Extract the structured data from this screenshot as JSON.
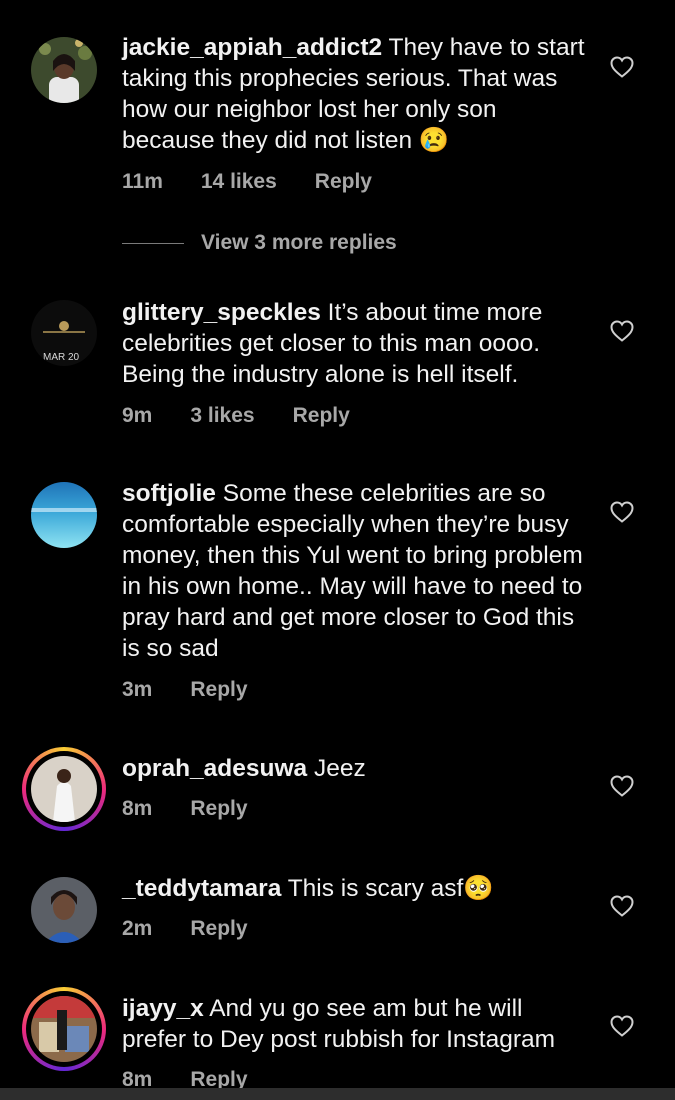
{
  "comments": [
    {
      "username": "jackie_appiah_addict2",
      "text": "They have to start taking this prophecies serious. That was how our neighbor lost her only son because they did not listen 😢",
      "time": "11m",
      "likes": "14 likes",
      "reply": "Reply"
    },
    {
      "username": "glittery_speckles",
      "avatar_text": "MAR 20",
      "text": "It’s about time more celebrities get closer to this man oooo. Being the industry alone is hell itself.",
      "time": "9m",
      "likes": "3 likes",
      "reply": "Reply"
    },
    {
      "username": "softjolie",
      "text": "Some these celebrities are so comfortable especially when they’re busy money, then this Yul went to bring problem in his own home.. May will have to need to pray hard and get more closer to God this is so sad",
      "time": "3m",
      "reply": "Reply"
    },
    {
      "username": "oprah_adesuwa",
      "text": "Jeez",
      "time": "8m",
      "reply": "Reply"
    },
    {
      "username": "_teddytamara",
      "text": "This is scary asf🥺",
      "time": "2m",
      "reply": "Reply"
    },
    {
      "username": "ijayy_x",
      "text": "And yu go see am but he will prefer to Dey post rubbish for Instagram",
      "time": "8m",
      "reply": "Reply"
    }
  ],
  "view_replies": "View 3 more replies",
  "colors": {
    "background": "#000000",
    "text": "#f2f2f2",
    "meta": "#a8a8a8"
  },
  "icons": {
    "like": "heart-outline-icon"
  }
}
